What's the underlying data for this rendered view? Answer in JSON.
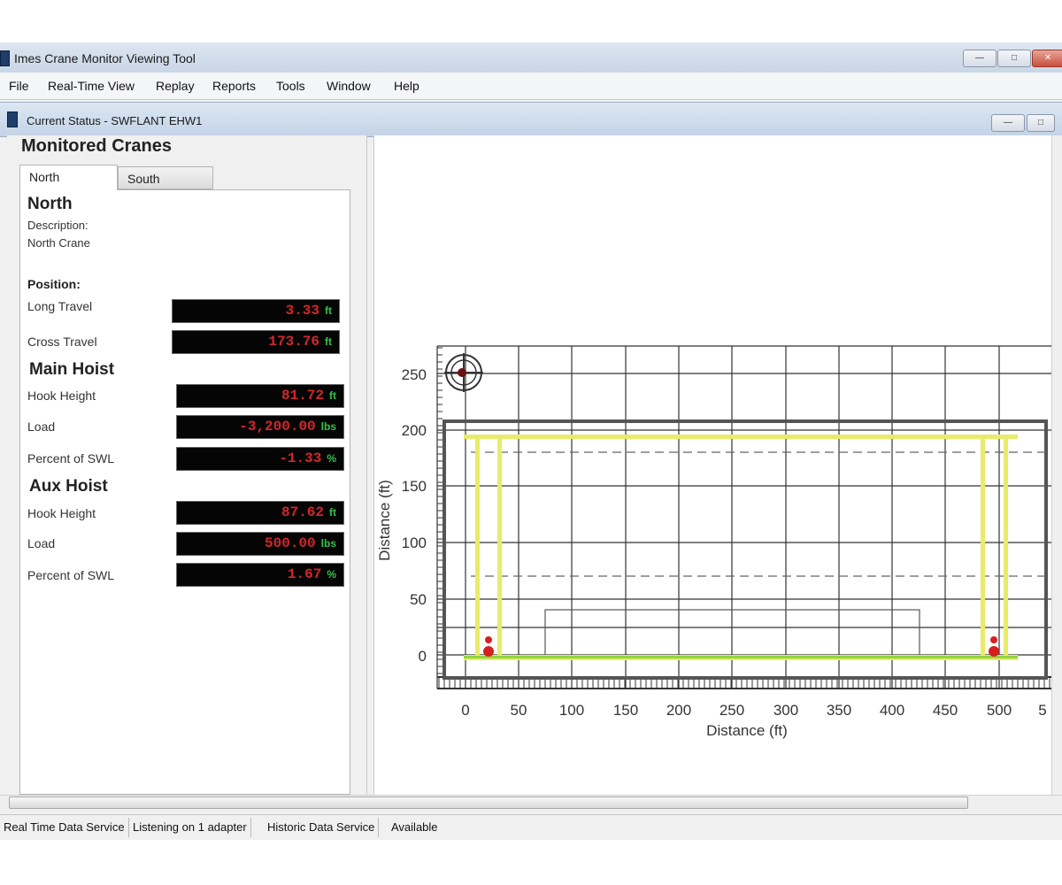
{
  "window": {
    "title": "Imes Crane Monitor Viewing Tool",
    "controls": [
      "—",
      "□",
      "✕"
    ]
  },
  "menu": [
    "File",
    "Real-Time View",
    "Replay",
    "Reports",
    "Tools",
    "Window",
    "Help"
  ],
  "child_window": {
    "title": "Current Status - SWFLANT EHW1",
    "controls": [
      "—",
      "□"
    ]
  },
  "panel": {
    "heading": "Monitored Cranes",
    "tabs": [
      "North",
      "South"
    ],
    "crane": {
      "name": "North",
      "description_label": "Description:",
      "description": "North Crane"
    },
    "position": {
      "heading": "Position:",
      "long_travel": {
        "label": "Long Travel",
        "value": "3.33",
        "unit": "ft"
      },
      "cross_travel": {
        "label": "Cross Travel",
        "value": "173.76",
        "unit": "ft"
      }
    },
    "main_hoist": {
      "heading": "Main Hoist",
      "hook_height": {
        "label": "Hook Height",
        "value": "81.72",
        "unit": "ft"
      },
      "load": {
        "label": "Load",
        "value": "-3,200.00",
        "unit": "lbs"
      },
      "percent_swl": {
        "label": "Percent of SWL",
        "value": "-1.33",
        "unit": "%"
      }
    },
    "aux_hoist": {
      "heading": "Aux Hoist",
      "hook_height": {
        "label": "Hook Height",
        "value": "87.62",
        "unit": "ft"
      },
      "load": {
        "label": "Load",
        "value": "500.00",
        "unit": "lbs"
      },
      "percent_swl": {
        "label": "Percent of SWL",
        "value": "1.67",
        "unit": "%"
      }
    }
  },
  "plot": {
    "xlabel": "Distance (ft)",
    "ylabel": "Distance (ft)",
    "x_ticks": [
      "0",
      "50",
      "100",
      "150",
      "200",
      "250",
      "300",
      "350",
      "400",
      "450",
      "500",
      "5"
    ],
    "y_ticks": [
      "0",
      "50",
      "100",
      "150",
      "200",
      "250"
    ],
    "colors": {
      "rail": "#e8ec6a",
      "rail_green": "#8fd63a",
      "marker": "#d62020",
      "frame": "#555555"
    }
  },
  "statusbar": {
    "items": [
      "Real Time Data Service",
      "Listening on 1 adapter",
      "Historic Data Service",
      "Available"
    ]
  }
}
